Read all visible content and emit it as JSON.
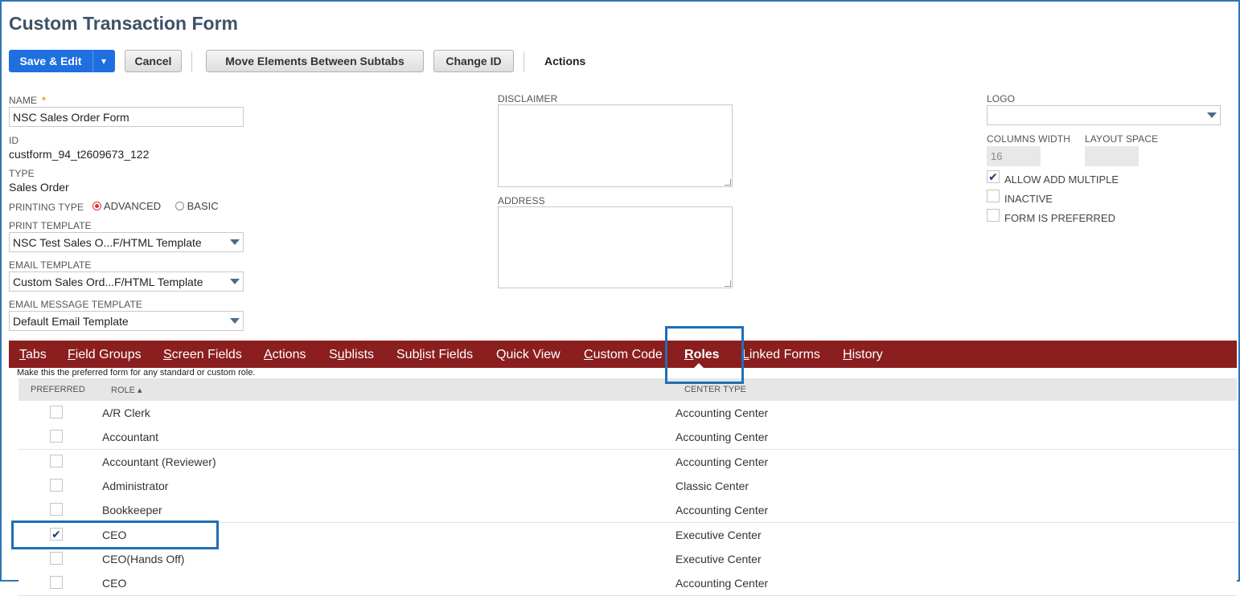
{
  "page": {
    "title": "Custom Transaction Form"
  },
  "toolbar": {
    "save_edit": "Save & Edit",
    "save_arrow": "▾",
    "cancel": "Cancel",
    "move_elements": "Move Elements Between Subtabs",
    "change_id": "Change ID",
    "actions": "Actions"
  },
  "form": {
    "name_label": "NAME",
    "name_required": "*",
    "name_value": "NSC Sales Order Form",
    "id_label": "ID",
    "id_value": "custform_94_t2609673_122",
    "type_label": "TYPE",
    "type_value": "Sales Order",
    "printing_type_label": "PRINTING TYPE",
    "printing_advanced": "ADVANCED",
    "printing_basic": "BASIC",
    "print_template_label": "PRINT TEMPLATE",
    "print_template_value": "NSC Test Sales O...F/HTML Template",
    "email_template_label": "EMAIL TEMPLATE",
    "email_template_value": "Custom Sales Ord...F/HTML Template",
    "email_message_label": "EMAIL MESSAGE TEMPLATE",
    "email_message_value": "Default Email Template",
    "disclaimer_label": "DISCLAIMER",
    "address_label": "ADDRESS",
    "logo_label": "LOGO",
    "logo_value": "",
    "columns_width_label": "COLUMNS WIDTH",
    "columns_width_value": "16",
    "layout_space_label": "LAYOUT SPACE",
    "layout_space_value": "",
    "allow_add_multiple_label": "ALLOW ADD MULTIPLE",
    "inactive_label": "INACTIVE",
    "form_preferred_label": "FORM IS PREFERRED"
  },
  "tabs": [
    {
      "pre": "",
      "u": "T",
      "post": "abs"
    },
    {
      "pre": "",
      "u": "F",
      "post": "ield Groups"
    },
    {
      "pre": "",
      "u": "S",
      "post": "creen Fields"
    },
    {
      "pre": "",
      "u": "A",
      "post": "ctions"
    },
    {
      "pre": "S",
      "u": "u",
      "post": "blists"
    },
    {
      "pre": "Sub",
      "u": "l",
      "post": "ist Fields"
    },
    {
      "pre": "Quick View",
      "u": "",
      "post": ""
    },
    {
      "pre": "",
      "u": "C",
      "post": "ustom Code"
    },
    {
      "pre": "",
      "u": "R",
      "post": "oles"
    },
    {
      "pre": "",
      "u": "L",
      "post": "inked Forms"
    },
    {
      "pre": "",
      "u": "H",
      "post": "istory"
    }
  ],
  "roles_tab": {
    "hint": "Make this the preferred form for any standard or custom role.",
    "col_preferred": "PREFERRED",
    "col_role": "ROLE ▴",
    "col_center": "CENTER TYPE",
    "rows": [
      {
        "role": "A/R Clerk",
        "center": "Accounting Center",
        "checked": false
      },
      {
        "role": "Accountant",
        "center": "Accounting Center",
        "checked": false
      },
      {
        "role": "Accountant (Reviewer)",
        "center": "Accounting Center",
        "checked": false
      },
      {
        "role": "Administrator",
        "center": "Classic Center",
        "checked": false
      },
      {
        "role": "Bookkeeper",
        "center": "Accounting Center",
        "checked": false
      },
      {
        "role": "CEO",
        "center": "Executive Center",
        "checked": true
      },
      {
        "role": "CEO(Hands Off)",
        "center": "Executive Center",
        "checked": false
      },
      {
        "role": "CEO",
        "center": "Accounting Center",
        "checked": false
      }
    ]
  },
  "colors": {
    "tabbar": "#8b1e1e",
    "primary": "#1f6fe0",
    "highlight": "#1f6fb8"
  }
}
